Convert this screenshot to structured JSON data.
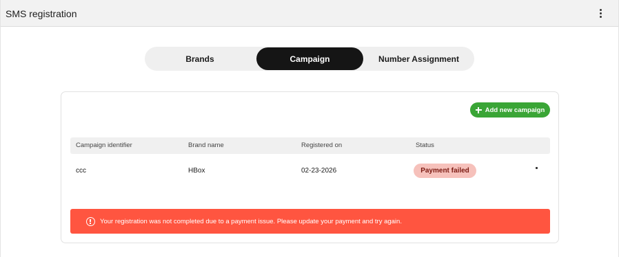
{
  "header": {
    "title": "SMS registration",
    "menu_icon": "more-vertical-icon"
  },
  "tabs": [
    {
      "label": "Brands",
      "active": false
    },
    {
      "label": "Campaign",
      "active": true
    },
    {
      "label": "Number Assignment",
      "active": false
    }
  ],
  "toolbar": {
    "add_label": "Add new campaign",
    "add_icon": "plus-icon"
  },
  "table": {
    "columns": [
      "Campaign identifier",
      "Brand name",
      "Registered on",
      "Status"
    ],
    "rows": [
      {
        "campaign_identifier": "ccc",
        "brand_name": "HBox",
        "registered_on": "02-23-2026",
        "status": "Payment failed"
      }
    ]
  },
  "alert": {
    "icon": "alert-circle-icon",
    "message": "Your registration was not completed due to a payment issue. Please update your payment and try again."
  },
  "colors": {
    "active_tab": "#151515",
    "add_button": "#3aa536",
    "status_badge": "#f6c1bb",
    "alert": "#ff5540"
  }
}
